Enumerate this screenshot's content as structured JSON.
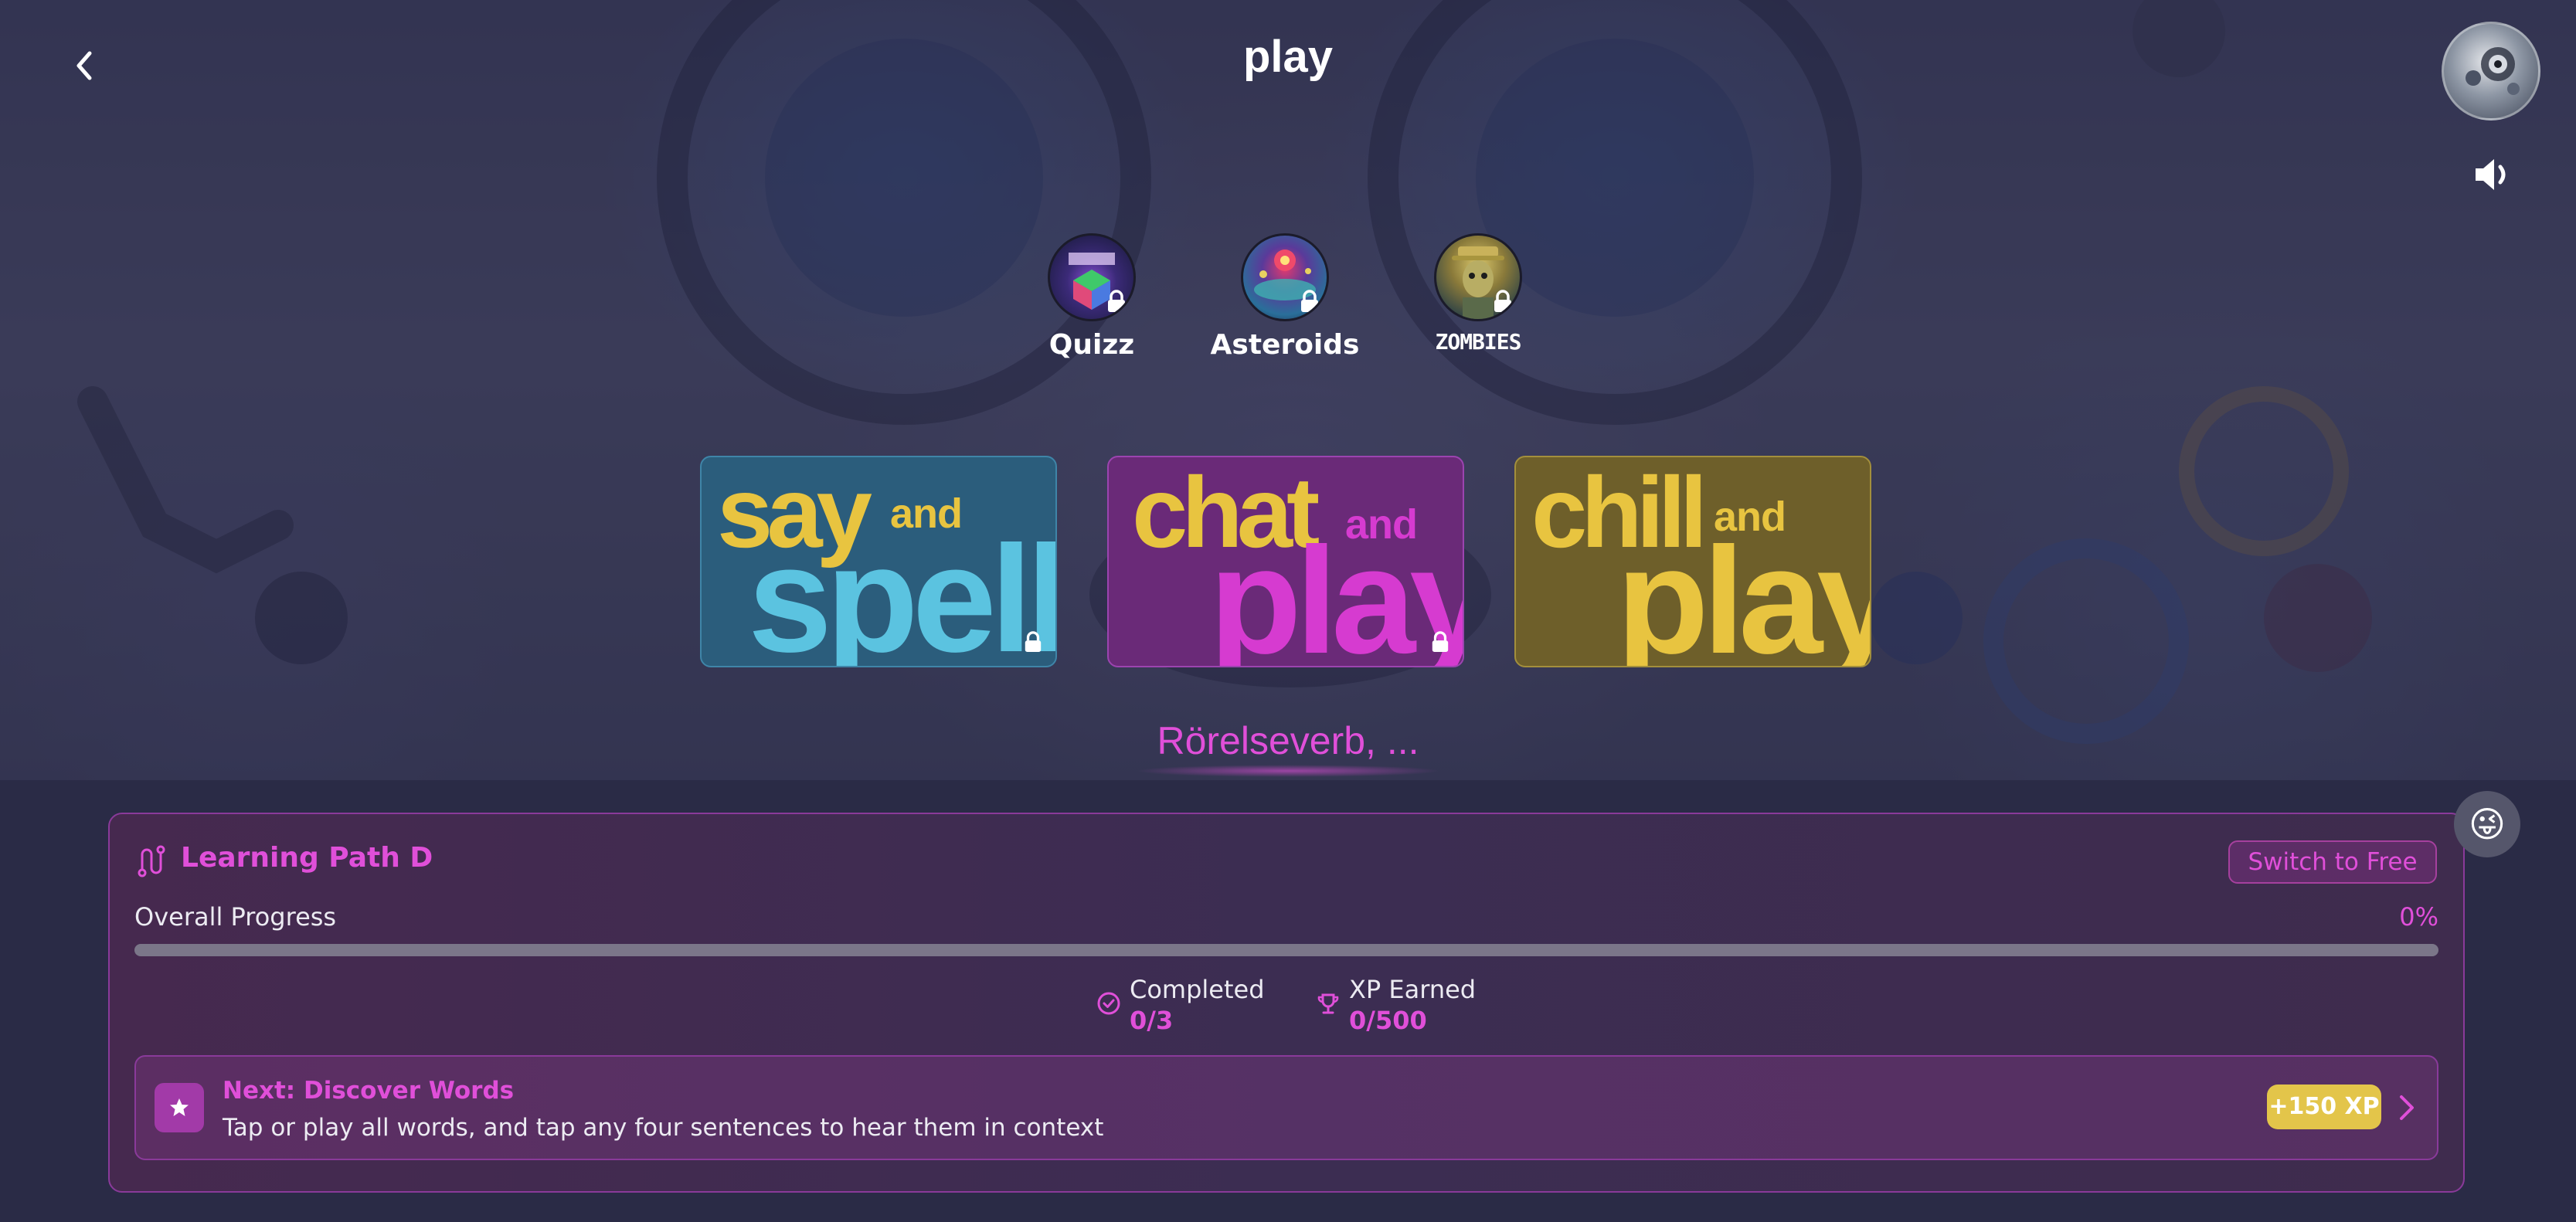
{
  "header": {
    "title": "play",
    "back_icon": "chevron-left-icon",
    "sound_icon": "speaker-icon"
  },
  "games": [
    {
      "name": "Quizz",
      "locked": true
    },
    {
      "name": "Asteroids",
      "locked": true
    },
    {
      "name": "ZOMBIES",
      "locked": true
    }
  ],
  "modes": [
    {
      "line1": "say",
      "connector": "and",
      "line2": "spell",
      "locked": true
    },
    {
      "line1": "chat",
      "connector": "and",
      "line2": "play",
      "locked": true
    },
    {
      "line1": "chill",
      "connector": "and",
      "line2": "play",
      "locked": false
    }
  ],
  "topic": "Rörelseverb, ...",
  "learning_path": {
    "title": "Learning Path D",
    "switch_label": "Switch to Free",
    "progress_label": "Overall Progress",
    "progress_value": "0%",
    "progress_fraction": 0,
    "stats": [
      {
        "label": "Completed",
        "value": "0/3",
        "icon": "check-circle-icon"
      },
      {
        "label": "XP Earned",
        "value": "0/500",
        "icon": "trophy-icon"
      }
    ],
    "next": {
      "title": "Next: Discover Words",
      "description": "Tap or play all words, and tap any four sentences to hear them in context",
      "xp": "+150 XP",
      "icon": "star-icon"
    }
  },
  "emoji": "😜",
  "colors": {
    "accent": "#e04fd9",
    "xp_badge": "#e3c54a",
    "say_blue": "#5bc3e0",
    "chat_magenta": "#d63bd0",
    "chill_yellow": "#e8c440"
  }
}
